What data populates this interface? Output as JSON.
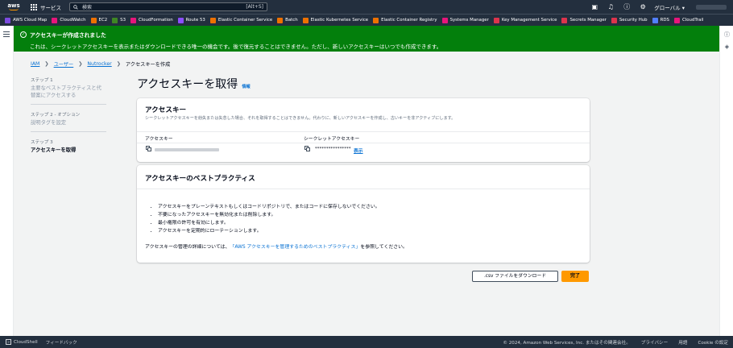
{
  "topnav": {
    "logo": "aws",
    "services_label": "サービス",
    "search_placeholder": "検索",
    "search_shortcut": "[Alt+S]",
    "region_label": "グローバル ▾",
    "icons": [
      "cloudshell-icon",
      "bell-icon",
      "help-icon",
      "gear-icon"
    ]
  },
  "favorites": [
    {
      "label": "AWS Cloud Map",
      "color": "#7d4be0"
    },
    {
      "label": "CloudWatch",
      "color": "#e7157b"
    },
    {
      "label": "EC2",
      "color": "#ed7100"
    },
    {
      "label": "S3",
      "color": "#3f8624"
    },
    {
      "label": "CloudFormation",
      "color": "#e7157b"
    },
    {
      "label": "Route 53",
      "color": "#8c4fff"
    },
    {
      "label": "Elastic Container Service",
      "color": "#ed7100"
    },
    {
      "label": "Batch",
      "color": "#ed7100"
    },
    {
      "label": "Elastic Kubernetes Service",
      "color": "#ed7100"
    },
    {
      "label": "Elastic Container Registry",
      "color": "#ed7100"
    },
    {
      "label": "Systems Manager",
      "color": "#e7157b"
    },
    {
      "label": "Key Management Service",
      "color": "#dd344c"
    },
    {
      "label": "Secrets Manager",
      "color": "#dd344c"
    },
    {
      "label": "Security Hub",
      "color": "#dd344c"
    },
    {
      "label": "RDS",
      "color": "#527fff"
    },
    {
      "label": "CloudTrail",
      "color": "#e7157b"
    }
  ],
  "flash": {
    "title": "アクセスキーが作成されました",
    "message": "これは、シークレットアクセスキーを表示またはダウンロードできる唯一の機会です。後で復元することはできません。ただし、新しいアクセスキーはいつでも作成できます。"
  },
  "breadcrumb": {
    "items": [
      "IAM",
      "ユーザー",
      "Nutrocker",
      "アクセスキーを作成"
    ]
  },
  "steps": [
    {
      "number": "ステップ 1",
      "label": "主要なベストプラクティスと代替案にアクセスする"
    },
    {
      "number": "ステップ 2 - オプション",
      "label": "説明タグを設定"
    },
    {
      "number": "ステップ 3",
      "label": "アクセスキーを取得"
    }
  ],
  "page": {
    "title": "アクセスキーを取得",
    "info_link": "情報"
  },
  "access_key_card": {
    "title": "アクセスキー",
    "description": "シークレットアクセスキーを紛失または失念した場合、それを取得することはできません。代わりに、新しいアクセスキーを作成し、古いキーを非アクティブにします。",
    "col_access_key": "アクセスキー",
    "col_secret_key": "シークレットアクセスキー",
    "secret_masked": "****************",
    "show_label": "表示"
  },
  "best_practices": {
    "title": "アクセスキーのベストプラクティス",
    "items": [
      "アクセスキーをプレーンテキストもしくはコードリポジトリで、またはコードに保存しないでください。",
      "不要になったアクセスキーを無効化または削除します。",
      "最小権限の許可を有効にします。",
      "アクセスキーを定期的にローテーションします。"
    ],
    "footer_prefix": "アクセスキーの管理の詳細については、",
    "footer_link": "「AWS アクセスキーを管理するためのベストプラクティス」",
    "footer_suffix": "を参照してください。"
  },
  "actions": {
    "download_csv": ".csv ファイルをダウンロード",
    "done": "完了"
  },
  "footer": {
    "cloudshell": "CloudShell",
    "feedback": "フィードバック",
    "copyright": "© 2024, Amazon Web Services, Inc. またはその関連会社。",
    "privacy": "プライバシー",
    "terms": "用語",
    "cookie": "Cookie の設定"
  }
}
